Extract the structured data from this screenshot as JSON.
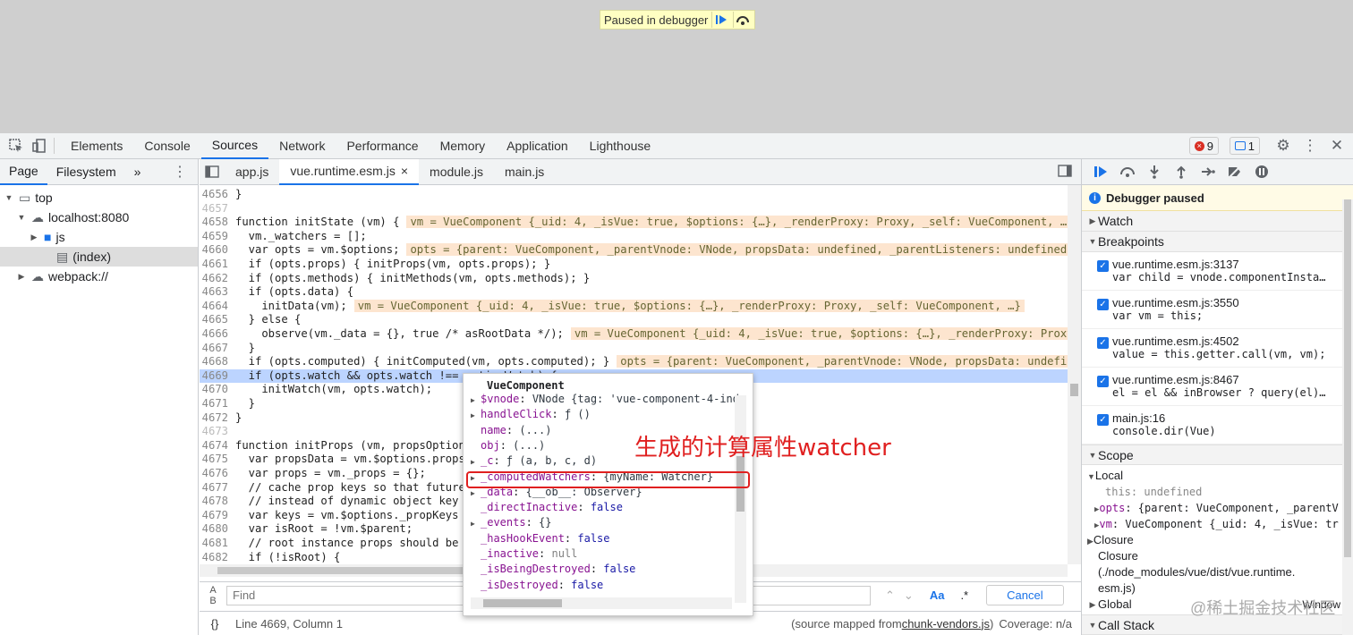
{
  "paused_banner": {
    "text": "Paused in debugger"
  },
  "panel_tabs": [
    "Elements",
    "Console",
    "Sources",
    "Network",
    "Performance",
    "Memory",
    "Application",
    "Lighthouse"
  ],
  "active_panel": "Sources",
  "badges": {
    "errors": "9",
    "messages": "1"
  },
  "left": {
    "tabs": [
      "Page",
      "Filesystem"
    ],
    "more": "»",
    "tree": [
      {
        "label": "top",
        "indent": 0,
        "icon": "window"
      },
      {
        "label": "localhost:8080",
        "indent": 1,
        "icon": "cloud"
      },
      {
        "label": "js",
        "indent": 2,
        "icon": "folder"
      },
      {
        "label": "(index)",
        "indent": 3,
        "icon": "file"
      },
      {
        "label": "webpack://",
        "indent": 1,
        "icon": "cloud"
      }
    ]
  },
  "editor_tabs": [
    "app.js",
    "vue.runtime.esm.js",
    "module.js",
    "main.js"
  ],
  "active_editor_tab": "vue.runtime.esm.js",
  "code_lines": [
    {
      "n": "4656",
      "code": "}",
      "inline": ""
    },
    {
      "n": "4657",
      "code": "",
      "inline": ""
    },
    {
      "n": "4658",
      "code": "function initState (vm) {",
      "inline": "vm = VueComponent {_uid: 4, _isVue: true, $options: {…}, _renderProxy: Proxy, _self: VueComponent, …}"
    },
    {
      "n": "4659",
      "code": "  vm._watchers = [];",
      "inline": ""
    },
    {
      "n": "4660",
      "code": "  var opts = vm.$options;",
      "inline": "opts = {parent: VueComponent, _parentVnode: VNode, propsData: undefined, _parentListeners: undefined,"
    },
    {
      "n": "4661",
      "code": "  if (opts.props) { initProps(vm, opts.props); }",
      "inline": ""
    },
    {
      "n": "4662",
      "code": "  if (opts.methods) { initMethods(vm, opts.methods); }",
      "inline": ""
    },
    {
      "n": "4663",
      "code": "  if (opts.data) {",
      "inline": ""
    },
    {
      "n": "4664",
      "code": "    initData(vm);",
      "inline": "vm = VueComponent {_uid: 4, _isVue: true, $options: {…}, _renderProxy: Proxy, _self: VueComponent, …}"
    },
    {
      "n": "4665",
      "code": "  } else {",
      "inline": ""
    },
    {
      "n": "4666",
      "code": "    observe(vm._data = {}, true /* asRootData */);",
      "inline": "vm = VueComponent {_uid: 4, _isVue: true, $options: {…}, _renderProxy: Proxy"
    },
    {
      "n": "4667",
      "code": "  }",
      "inline": ""
    },
    {
      "n": "4668",
      "code": "  if (opts.computed) { initComputed(vm, opts.computed); }",
      "inline": "opts = {parent: VueComponent, _parentVnode: VNode, propsData: undefine"
    },
    {
      "n": "4669",
      "code": "  if (opts.watch && opts.watch !== nativeWatch) {",
      "inline": ""
    },
    {
      "n": "4670",
      "code": "    initWatch(vm, opts.watch);",
      "inline": ""
    },
    {
      "n": "4671",
      "code": "  }",
      "inline": ""
    },
    {
      "n": "4672",
      "code": "}",
      "inline": ""
    },
    {
      "n": "4673",
      "code": "",
      "inline": ""
    },
    {
      "n": "4674",
      "code": "function initProps (vm, propsOptions) {",
      "inline": ""
    },
    {
      "n": "4675",
      "code": "  var propsData = vm.$options.propsData || {};",
      "inline": ""
    },
    {
      "n": "4676",
      "code": "  var props = vm._props = {};",
      "inline": ""
    },
    {
      "n": "4677",
      "code": "  // cache prop keys so that future props updates can iterate using Array",
      "inline": ""
    },
    {
      "n": "4678",
      "code": "  // instead of dynamic object key enumeration.",
      "inline": ""
    },
    {
      "n": "4679",
      "code": "  var keys = vm.$options._propKeys = [];",
      "inline": ""
    },
    {
      "n": "4680",
      "code": "  var isRoot = !vm.$parent;",
      "inline": ""
    },
    {
      "n": "4681",
      "code": "  // root instance props should be converted",
      "inline": ""
    },
    {
      "n": "4682",
      "code": "  if (!isRoot) {",
      "inline": ""
    }
  ],
  "find": {
    "placeholder": "Find",
    "aa": "Aa",
    "regex": ".*",
    "cancel": "Cancel"
  },
  "status": {
    "position": "Line 4669, Column 1",
    "source_prefix": "(source mapped from ",
    "source_link": "chunk-vendors.js",
    "source_suffix": ")",
    "coverage": "Coverage: n/a"
  },
  "right": {
    "paused": "Debugger paused",
    "watch": "Watch",
    "breakpoints_title": "Breakpoints",
    "breakpoints": [
      {
        "file": "vue.runtime.esm.js:3137",
        "code": "var child = vnode.componentInsta…"
      },
      {
        "file": "vue.runtime.esm.js:3550",
        "code": "var vm = this;"
      },
      {
        "file": "vue.runtime.esm.js:4502",
        "code": "value = this.getter.call(vm, vm);"
      },
      {
        "file": "vue.runtime.esm.js:8467",
        "code": "el = el && inBrowser ? query(el)…"
      },
      {
        "file": "main.js:16",
        "code": "console.dir(Vue)"
      }
    ],
    "scope_title": "Scope",
    "local": "Local",
    "this_line": "this: undefined",
    "opts_key": "opts",
    "opts_val": "{parent: VueComponent, _parentV",
    "vm_key": "vm",
    "vm_val": "VueComponent {_uid: 4, _isVue: tr",
    "closure1": "Closure",
    "closure2": "Closure",
    "closure2_path": "(./node_modules/vue/dist/vue.runtime.",
    "closure2_path2": "esm.js)",
    "global": "Global",
    "global_val": "Window",
    "call_stack": "Call Stack"
  },
  "popover": {
    "title": "VueComponent",
    "rows": [
      {
        "key": "$vnode",
        "val": "VNode {tag: 'vue-component-4-ind",
        "exp": true,
        "type": "obj"
      },
      {
        "key": "handleClick",
        "val": "ƒ ()",
        "exp": true,
        "type": "obj"
      },
      {
        "key": "name",
        "val": "(...)",
        "exp": false,
        "type": "obj"
      },
      {
        "key": "obj",
        "val": "(...)",
        "exp": false,
        "type": "obj"
      },
      {
        "key": "_c",
        "val": "ƒ (a, b, c, d)",
        "exp": true,
        "type": "obj"
      },
      {
        "key": "_computedWatchers",
        "val": "{myName: Watcher}",
        "exp": true,
        "type": "obj"
      },
      {
        "key": "_data",
        "val": "{__ob__: Observer}",
        "exp": true,
        "type": "obj"
      },
      {
        "key": "_directInactive",
        "val": "false",
        "exp": false,
        "type": "bool"
      },
      {
        "key": "_events",
        "val": "{}",
        "exp": true,
        "type": "obj"
      },
      {
        "key": "_hasHookEvent",
        "val": "false",
        "exp": false,
        "type": "bool"
      },
      {
        "key": "_inactive",
        "val": "null",
        "exp": false,
        "type": "null"
      },
      {
        "key": "_isBeingDestroyed",
        "val": "false",
        "exp": false,
        "type": "bool"
      },
      {
        "key": "_isDestroyed",
        "val": "false",
        "exp": false,
        "type": "bool"
      }
    ]
  },
  "annotation": "生成的计算属性watcher",
  "watermark": "@稀土掘金技术社区",
  "colors": {
    "accent": "#1a73e8",
    "highlight": "#e02020",
    "exec_line": "#bcd4ff",
    "inline_value": "#fde5cf"
  }
}
